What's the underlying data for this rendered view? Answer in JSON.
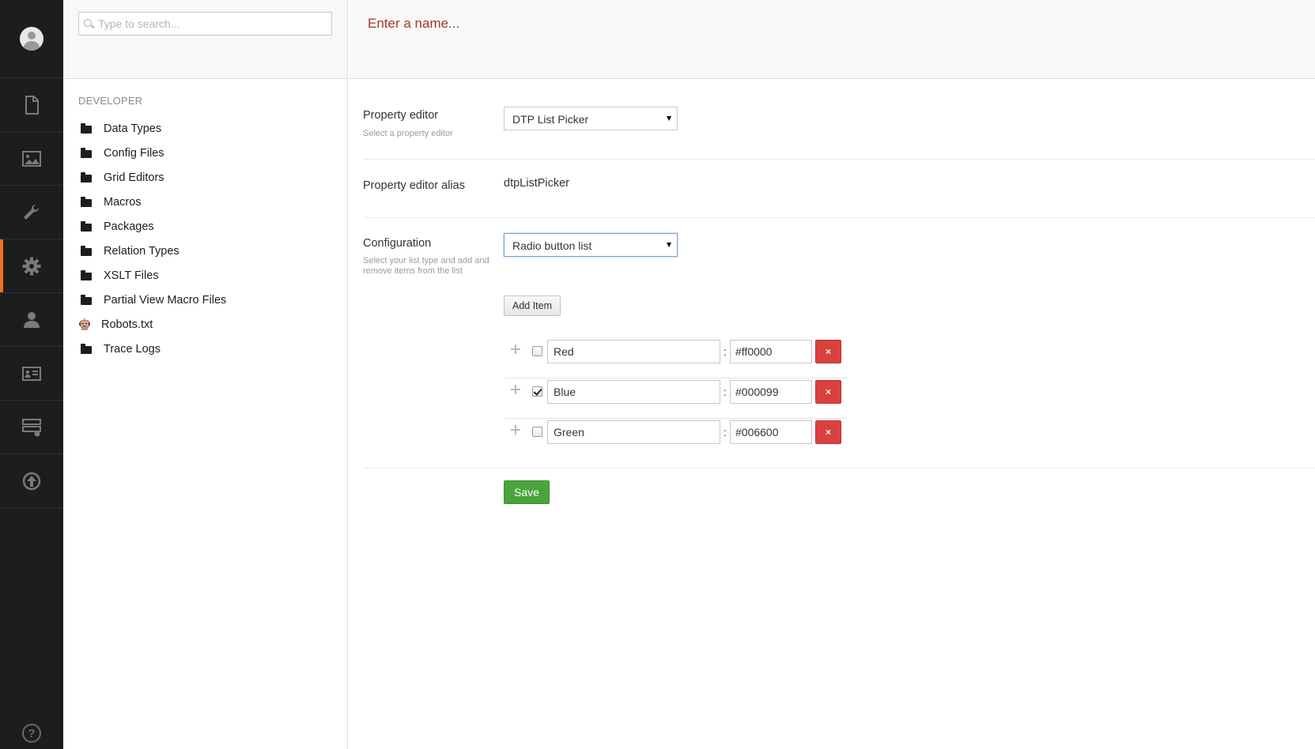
{
  "search": {
    "placeholder": "Type to search..."
  },
  "nav": {
    "items": [
      {
        "icon": "document-icon"
      },
      {
        "icon": "media-icon"
      },
      {
        "icon": "wrench-icon"
      },
      {
        "icon": "gear-icon",
        "active": true
      },
      {
        "icon": "user-icon"
      },
      {
        "icon": "member-card-icon"
      },
      {
        "icon": "forms-icon"
      },
      {
        "icon": "deploy-icon"
      }
    ],
    "help_label": "?"
  },
  "tree": {
    "section_title": "DEVELOPER",
    "items": [
      {
        "label": "Data Types",
        "icon": "folder-icon"
      },
      {
        "label": "Config Files",
        "icon": "folder-icon"
      },
      {
        "label": "Grid Editors",
        "icon": "folder-icon"
      },
      {
        "label": "Macros",
        "icon": "folder-icon"
      },
      {
        "label": "Packages",
        "icon": "folder-icon"
      },
      {
        "label": "Relation Types",
        "icon": "folder-icon"
      },
      {
        "label": "XSLT Files",
        "icon": "folder-icon"
      },
      {
        "label": "Partial View Macro Files",
        "icon": "folder-icon"
      },
      {
        "label": "Robots.txt",
        "icon": "robot-icon"
      },
      {
        "label": "Trace Logs",
        "icon": "folder-icon"
      }
    ]
  },
  "editor": {
    "name_placeholder": "Enter a name...",
    "property_editor": {
      "label": "Property editor",
      "description": "Select a property editor",
      "value": "DTP List Picker"
    },
    "alias": {
      "label": "Property editor alias",
      "value": "dtpListPicker"
    },
    "configuration": {
      "label": "Configuration",
      "description": "Select your list type and add and remove items from the list",
      "value": "Radio button list"
    },
    "add_item_label": "Add Item",
    "items": [
      {
        "name": "Red",
        "value": "#ff0000",
        "checked": false
      },
      {
        "name": "Blue",
        "value": "#000099",
        "checked": true
      },
      {
        "name": "Green",
        "value": "#006600",
        "checked": false
      }
    ],
    "separator": ":",
    "delete_label": "×",
    "save_label": "Save"
  },
  "colors": {
    "nav_bg": "#1d1d1d",
    "active_accent": "#f36f21",
    "name_placeholder": "#a2362c",
    "delete_button": "#d9413f",
    "save_button": "#4aa43c"
  }
}
